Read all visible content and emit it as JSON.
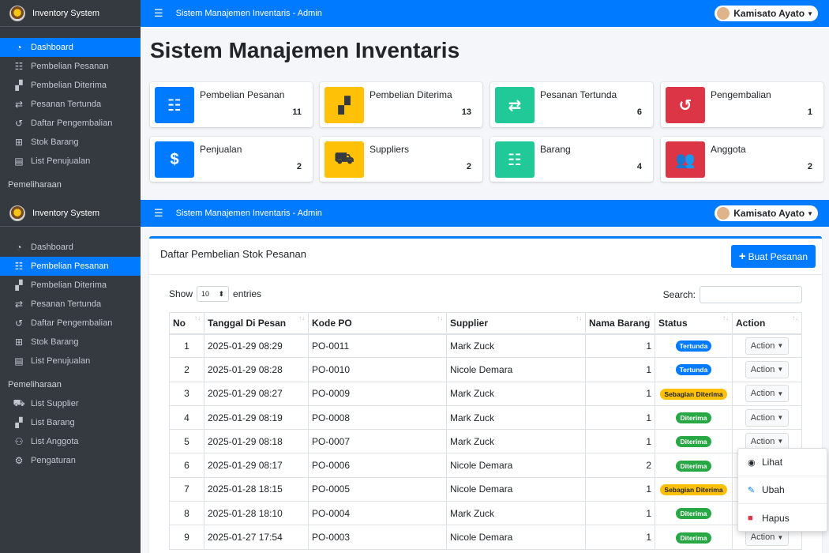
{
  "brand": "Inventory System",
  "header_title": "Sistem Manajemen Inventaris - Admin",
  "user_name": "Kamisato Ayato",
  "sidebar": {
    "items": [
      {
        "label": "Dashboard",
        "icon": "tachometer-icon"
      },
      {
        "label": "Pembelian Pesanan",
        "icon": "table-icon"
      },
      {
        "label": "Pembelian Diterima",
        "icon": "boxes-icon"
      },
      {
        "label": "Pesanan Tertunda",
        "icon": "exchange-icon"
      },
      {
        "label": "Daftar Pengembalian",
        "icon": "undo-icon"
      },
      {
        "label": "Stok Barang",
        "icon": "grid-icon"
      },
      {
        "label": "List Penujualan",
        "icon": "receipt-icon"
      }
    ],
    "section": "Pemeliharaan",
    "maint_items": [
      {
        "label": "List Supplier",
        "icon": "truck-loading-icon"
      },
      {
        "label": "List Barang",
        "icon": "boxes-icon"
      },
      {
        "label": "List Anggota",
        "icon": "users-icon"
      },
      {
        "label": "Pengaturan",
        "icon": "cogs-icon"
      }
    ]
  },
  "dashboard": {
    "title": "Sistem Manajemen Inventaris",
    "boxes": [
      {
        "label": "Pembelian Pesanan",
        "value": "11",
        "color": "#007bff",
        "icon": "table-icon"
      },
      {
        "label": "Pembelian Diterima",
        "value": "13",
        "color": "#ffc107",
        "icon": "boxes-icon"
      },
      {
        "label": "Pesanan Tertunda",
        "value": "6",
        "color": "#20c997",
        "icon": "exchange-icon"
      },
      {
        "label": "Pengembalian",
        "value": "1",
        "color": "#dc3545",
        "icon": "undo-icon"
      },
      {
        "label": "Penjualan",
        "value": "2",
        "color": "#007bff",
        "icon": "file-invoice-icon"
      },
      {
        "label": "Suppliers",
        "value": "2",
        "color": "#ffc107",
        "icon": "truck-loading-icon"
      },
      {
        "label": "Barang",
        "value": "4",
        "color": "#20c997",
        "icon": "table-icon"
      },
      {
        "label": "Anggota",
        "value": "2",
        "color": "#dc3545",
        "icon": "users-icon"
      }
    ]
  },
  "list": {
    "title": "Daftar Pembelian Stok Pesanan",
    "add_button": "Buat Pesanan",
    "show_label": "Show",
    "entries_value": "10",
    "entries_label": "entries",
    "search_label": "Search:",
    "columns": [
      "No",
      "Tanggal Di Pesan",
      "Kode PO",
      "Supplier",
      "Nama Barang",
      "Status",
      "Action"
    ],
    "rows": [
      {
        "no": "1",
        "date": "2025-01-29 08:29",
        "po": "PO-0011",
        "supplier": "Mark Zuck",
        "qty": "1",
        "status": "Tertunda",
        "status_type": "blue"
      },
      {
        "no": "2",
        "date": "2025-01-29 08:28",
        "po": "PO-0010",
        "supplier": "Nicole Demara",
        "qty": "1",
        "status": "Tertunda",
        "status_type": "blue"
      },
      {
        "no": "3",
        "date": "2025-01-29 08:27",
        "po": "PO-0009",
        "supplier": "Mark Zuck",
        "qty": "1",
        "status": "Sebagian Diterima",
        "status_type": "yellow"
      },
      {
        "no": "4",
        "date": "2025-01-29 08:19",
        "po": "PO-0008",
        "supplier": "Mark Zuck",
        "qty": "1",
        "status": "Diterima",
        "status_type": "green"
      },
      {
        "no": "5",
        "date": "2025-01-29 08:18",
        "po": "PO-0007",
        "supplier": "Mark Zuck",
        "qty": "1",
        "status": "Diterima",
        "status_type": "green"
      },
      {
        "no": "6",
        "date": "2025-01-29 08:17",
        "po": "PO-0006",
        "supplier": "Nicole Demara",
        "qty": "2",
        "status": "Diterima",
        "status_type": "green"
      },
      {
        "no": "7",
        "date": "2025-01-28 18:15",
        "po": "PO-0005",
        "supplier": "Nicole Demara",
        "qty": "1",
        "status": "Sebagian Diterima",
        "status_type": "yellow"
      },
      {
        "no": "8",
        "date": "2025-01-28 18:10",
        "po": "PO-0004",
        "supplier": "Mark Zuck",
        "qty": "1",
        "status": "Diterima",
        "status_type": "green"
      },
      {
        "no": "9",
        "date": "2025-01-27 17:54",
        "po": "PO-0003",
        "supplier": "Nicole Demara",
        "qty": "1",
        "status": "Diterima",
        "status_type": "green"
      }
    ],
    "action_label": "Action",
    "menu": [
      {
        "label": "Lihat",
        "icon": "eye-icon",
        "color": "#212529"
      },
      {
        "label": "Ubah",
        "icon": "edit-icon",
        "color": "#007bff"
      },
      {
        "label": "Hapus",
        "icon": "trash-icon",
        "color": "#dc3545"
      }
    ]
  }
}
